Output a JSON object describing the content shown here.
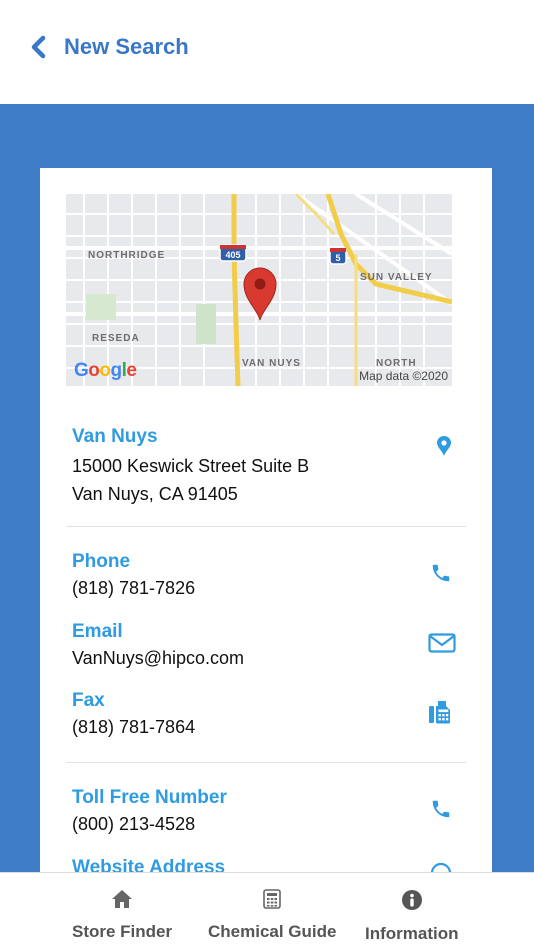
{
  "header": {
    "back_label": "New Search"
  },
  "map": {
    "labels": {
      "northridge": "NORTHRIDGE",
      "reseda": "RESEDA",
      "van_nuys": "VAN NUYS",
      "sun_valley": "SUN VALLEY",
      "north": "NORTH",
      "i405": "405",
      "i5": "5"
    },
    "google": "Google",
    "attribution": "Map data ©2020"
  },
  "location": {
    "name": "Van Nuys",
    "address_line1": "15000 Keswick Street Suite B",
    "address_line2": "Van Nuys, CA 91405"
  },
  "contact": {
    "phone_title": "Phone",
    "phone_value": "(818) 781-7826",
    "email_title": "Email",
    "email_value": "VanNuys@hipco.com",
    "fax_title": "Fax",
    "fax_value": "(818) 781-7864",
    "tollfree_title": "Toll Free Number",
    "tollfree_value": "(800) 213-4528",
    "website_title": "Website Address"
  },
  "tabs": [
    {
      "label": "Store Finder",
      "icon": "home-icon"
    },
    {
      "label": "Chemical Guide",
      "icon": "calculator-icon"
    },
    {
      "label": "Information",
      "icon": "info-icon"
    }
  ],
  "colors": {
    "accent": "#3a78c7",
    "background_blue": "#3e7cc6",
    "title_blue": "#2f9be0",
    "map_pin": "#d93a2f"
  }
}
